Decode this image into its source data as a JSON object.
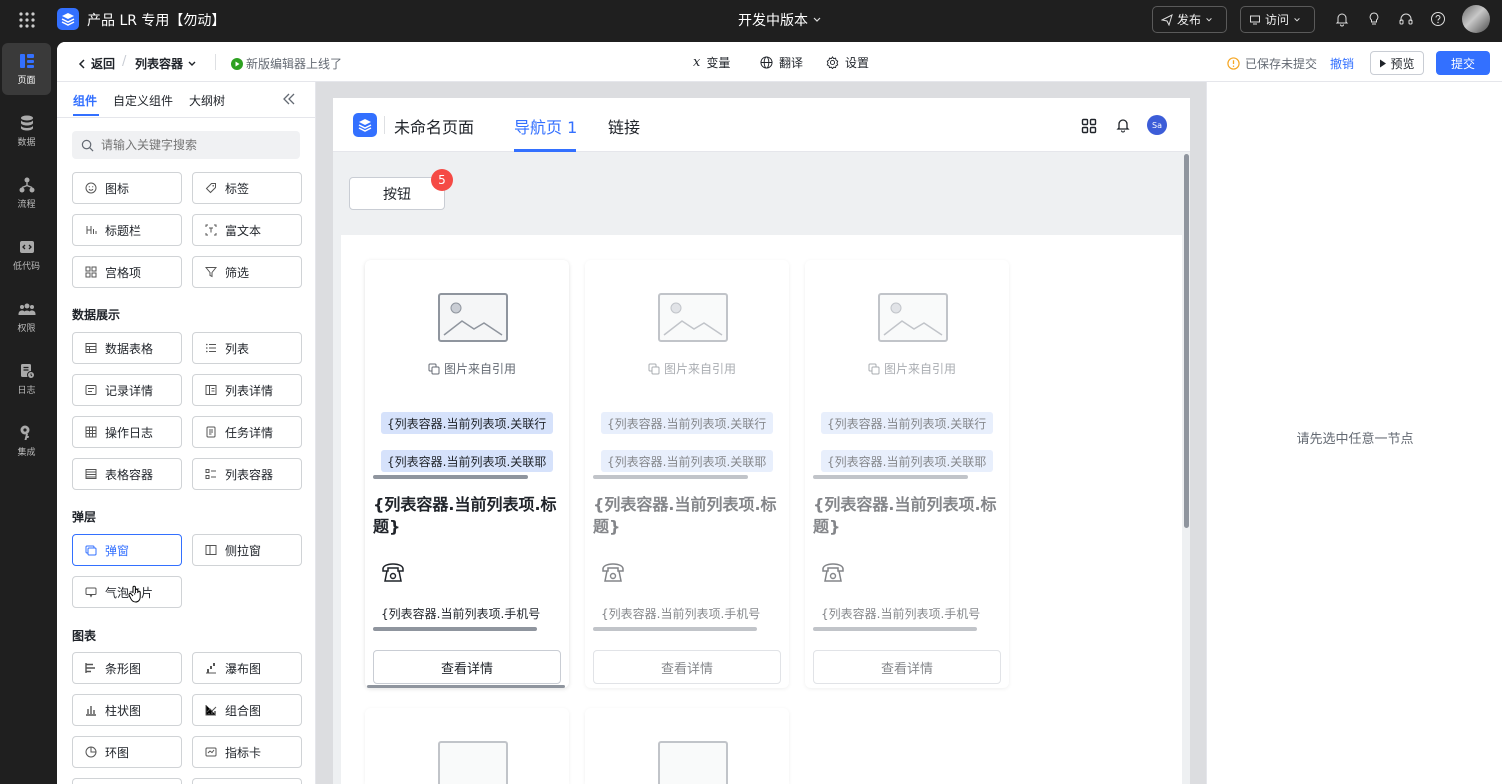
{
  "app": {
    "title": "产品 LR 专用【勿动】",
    "version_label": "开发中版本"
  },
  "topbar": {
    "publish": "发布",
    "visit": "访问"
  },
  "rail": [
    {
      "label": "页面",
      "icon": "page-icon"
    },
    {
      "label": "数据",
      "icon": "database-icon"
    },
    {
      "label": "流程",
      "icon": "flow-icon"
    },
    {
      "label": "低代码",
      "icon": "code-icon"
    },
    {
      "label": "权限",
      "icon": "users-icon"
    },
    {
      "label": "日志",
      "icon": "log-icon"
    },
    {
      "label": "集成",
      "icon": "key-icon"
    }
  ],
  "toolbar": {
    "back": "返回",
    "breadcrumb": "列表容器",
    "notice": "新版编辑器上线了",
    "variables": "变量",
    "translate": "翻译",
    "settings": "设置",
    "save_status": "已保存未提交",
    "undo": "撤销",
    "preview": "预览",
    "submit": "提交"
  },
  "panel": {
    "tabs": [
      "组件",
      "自定义组件",
      "大纲树"
    ],
    "search_placeholder": "请输入关键字搜索",
    "basic": [
      "图标",
      "标签",
      "标题栏",
      "富文本",
      "宫格项",
      "筛选"
    ],
    "sections": [
      "数据展示",
      "弹层",
      "图表"
    ],
    "data_display": [
      "数据表格",
      "列表",
      "记录详情",
      "列表详情",
      "操作日志",
      "任务详情",
      "表格容器",
      "列表容器"
    ],
    "overlay": [
      "弹窗",
      "侧拉窗",
      "气泡卡片"
    ],
    "charts": [
      "条形图",
      "瀑布图",
      "柱状图",
      "组合图",
      "环图",
      "指标卡"
    ]
  },
  "preview": {
    "page_title": "未命名页面",
    "nav_tabs": [
      "导航页 1",
      "链接"
    ],
    "avatar": "Sa",
    "button": "按钮",
    "badge": "5",
    "card": {
      "image_caption": "图片来自引用",
      "tag1": "{列表容器.当前列表项.关联行",
      "tag2": "{列表容器.当前列表项.关联耶",
      "title": "{列表容器.当前列表项.标题}",
      "phone": "{列表容器.当前列表项.手机号",
      "detail_button": "查看详情"
    }
  },
  "props": {
    "empty_hint": "请先选中任意一节点"
  }
}
